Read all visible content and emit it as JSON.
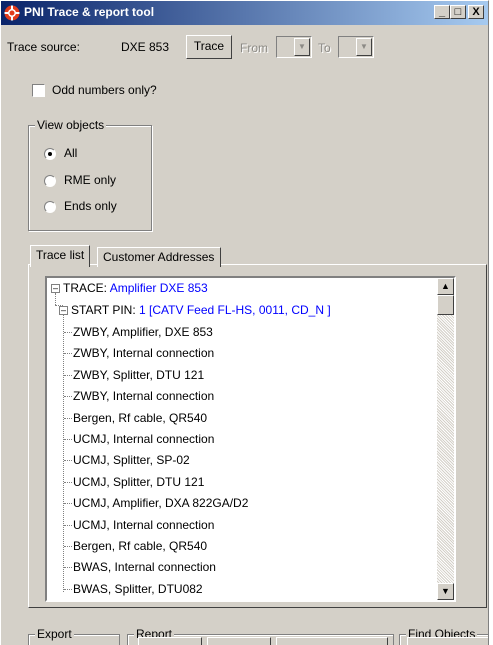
{
  "window": {
    "title": "PNI Trace & report tool",
    "minimize": "_",
    "maximize": "□",
    "close": "X"
  },
  "trace_source": {
    "label": "Trace source:",
    "value": "DXE 853",
    "trace_button": "Trace",
    "from_label": "From",
    "to_label": "To"
  },
  "odd_numbers": {
    "label": "Odd numbers only?",
    "checked": false
  },
  "view_objects": {
    "title": "View objects",
    "options": [
      "All",
      "RME only",
      "Ends only"
    ],
    "selected": "All"
  },
  "tabs": [
    {
      "label": "Trace list",
      "active": true
    },
    {
      "label": "Customer Addresses",
      "active": false
    }
  ],
  "tree": {
    "root_prefix": "TRACE:",
    "root_value": "Amplifier DXE 853",
    "start_prefix": "START PIN:",
    "start_value": "1 [CATV Feed FL-HS, 0011, CD_N ]",
    "items": [
      "ZWBY, Amplifier, DXE 853",
      "ZWBY, Internal connection",
      "ZWBY, Splitter, DTU 121",
      "ZWBY, Internal connection",
      "Bergen, Rf cable, QR540",
      "UCMJ, Internal connection",
      "UCMJ, Splitter, SP-02",
      "UCMJ, Splitter, DTU 121",
      "UCMJ, Amplifier, DXA 822GA/D2",
      "UCMJ, Internal connection",
      "Bergen, Rf cable, QR540",
      "BWAS, Internal connection",
      "BWAS, Splitter, DTU082"
    ]
  },
  "bottom": {
    "export_title": "Export",
    "report_title": "Report",
    "find_title": "Find Objects"
  },
  "colors": {
    "title_start": "#0a246a",
    "title_end": "#a6caf0",
    "face": "#d4d0c8",
    "tree_link": "#0000ff"
  }
}
